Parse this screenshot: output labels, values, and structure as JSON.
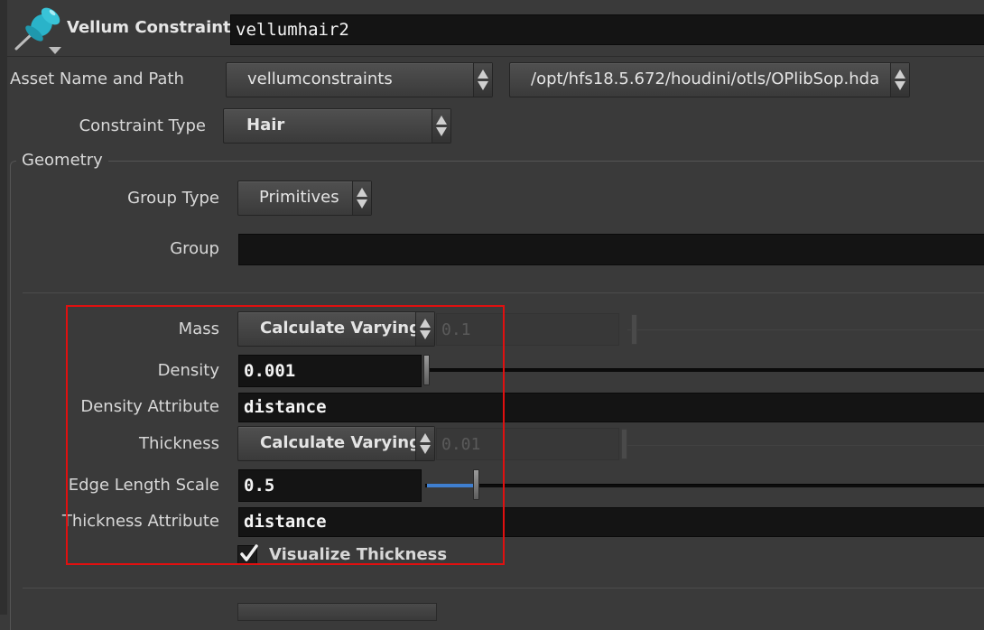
{
  "header": {
    "node_type": "Vellum Constraints",
    "node_name": "vellumhair2",
    "icon": "pushpin-icon"
  },
  "asset": {
    "label": "Asset Name and Path",
    "name": "vellumconstraints",
    "path": "/opt/hfs18.5.672/houdini/otls/OPlibSop.hda"
  },
  "constraint_type": {
    "label": "Constraint Type",
    "value": "Hair"
  },
  "geometry": {
    "title": "Geometry",
    "group_type_label": "Group Type",
    "group_type_value": "Primitives",
    "group_label": "Group",
    "group_value": ""
  },
  "params": {
    "mass": {
      "label": "Mass",
      "mode": "Calculate Varying",
      "value": "0.1"
    },
    "density": {
      "label": "Density",
      "value": "0.001",
      "slider_fraction": 0.0
    },
    "density_attribute": {
      "label": "Density Attribute",
      "value": "distance"
    },
    "thickness": {
      "label": "Thickness",
      "mode": "Calculate Varying",
      "value": "0.01"
    },
    "edge_length_scale": {
      "label": "Edge Length Scale",
      "value": "0.5",
      "slider_fraction": 0.09
    },
    "thickness_attribute": {
      "label": "Thickness Attribute",
      "value": "distance"
    },
    "visualize_thickness": {
      "label": "Visualize Thickness",
      "checked": true
    }
  },
  "colors": {
    "highlight_box": "#e01010",
    "slider_fill": "#3f7fd0"
  }
}
